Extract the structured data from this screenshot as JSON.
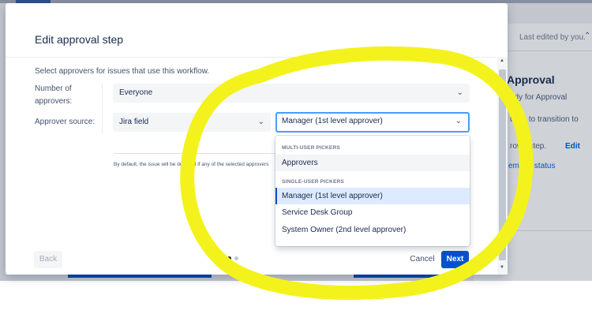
{
  "background": {
    "last_edited": "Last edited by you.",
    "expand_icon": "chevrons-up-icon",
    "panel_heading": "Approval",
    "panel_line1": "ady for Approval",
    "panel_line2": "uses to transition to",
    "panel_line3": "roval step.",
    "edit_link": "Edit",
    "remove_link": "emove status"
  },
  "modal": {
    "title": "Edit approval step",
    "instruction": "Select approvers for issues that use this workflow.",
    "number_label": "Number of approvers:",
    "number_value": "Everyone",
    "source_label": "Approver source:",
    "source_value": "Jira field",
    "field_value": "Manager (1st level approver)",
    "hint": "By default, the issue will be declined if any of the selected approvers",
    "back": "Back",
    "cancel": "Cancel",
    "next": "Next",
    "page_indicator": {
      "current": 1,
      "total": 2
    }
  },
  "dropdown": {
    "group1": "MULTI-USER PICKERS",
    "group1_items": [
      "Approvers"
    ],
    "group2": "SINGLE-USER PICKERS",
    "group2_items": [
      "Manager (1st level approver)",
      "Service Desk Group",
      "System Owner (2nd level approver)"
    ],
    "selected": "Manager (1st level approver)"
  },
  "colors": {
    "primary": "#0052cc",
    "focus_border": "#4c9aff",
    "selected_bg": "#deebff",
    "annotation": "#f4f21c"
  }
}
